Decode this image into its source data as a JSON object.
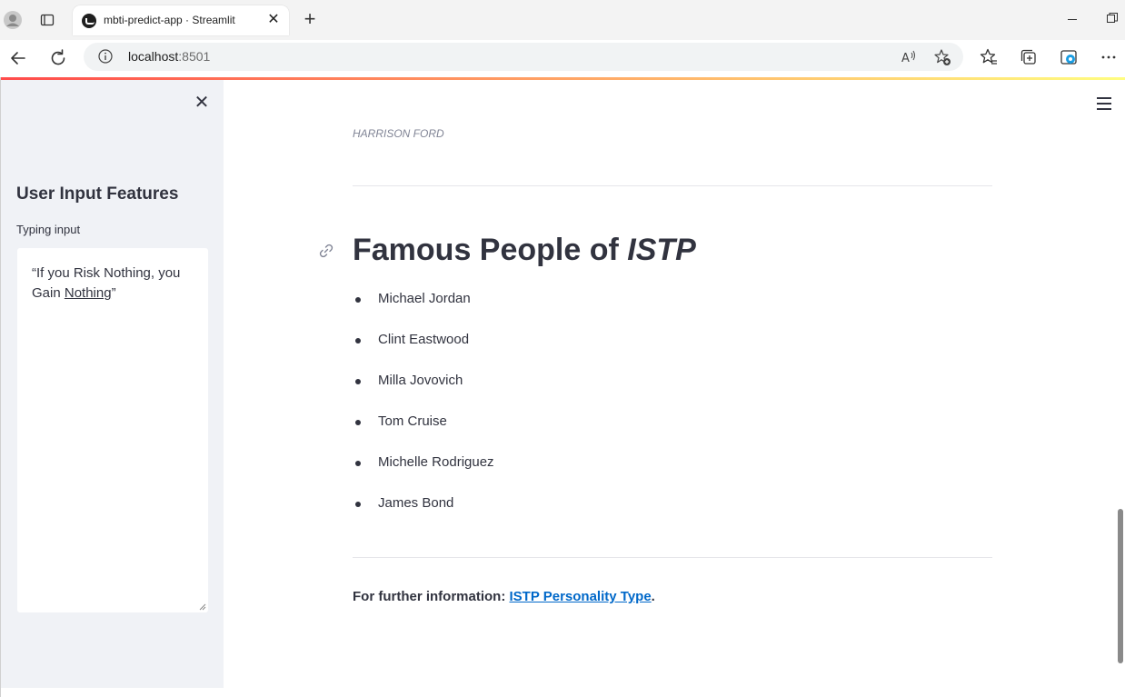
{
  "browser": {
    "tab_title": "mbti-predict-app · Streamlit",
    "url_host": "localhost",
    "url_port": ":8501"
  },
  "sidebar": {
    "header": "User Input Features",
    "input_label": "Typing input",
    "input_text_before": "“If you Risk Nothing, you Gain ",
    "input_text_underlined": "Nothing",
    "input_text_after": "”"
  },
  "main": {
    "previous_caption": "HARRISON FORD",
    "heading_prefix": "Famous People of ",
    "heading_type": "ISTP",
    "people": [
      "Michael Jordan",
      "Clint Eastwood",
      "Milla Jovovich",
      "Tom Cruise",
      "Michelle Rodriguez",
      "James Bond"
    ],
    "further_label": "For further information: ",
    "further_link": "ISTP Personality Type",
    "further_suffix": "."
  },
  "colors": {
    "sidebar_bg": "#f0f2f6",
    "text": "#31333f",
    "link": "#0068c9",
    "deco_start": "#ff4b4b",
    "deco_end": "#fffd80"
  },
  "icons": [
    "profile-icon",
    "tabs-icon",
    "close-icon",
    "plus-icon",
    "back-icon",
    "refresh-icon",
    "info-icon",
    "read-aloud-icon",
    "add-favorite-icon",
    "favorites-icon",
    "collections-icon",
    "edge-copilot-icon",
    "more-icon",
    "link-icon",
    "hamburger-menu-icon"
  ]
}
